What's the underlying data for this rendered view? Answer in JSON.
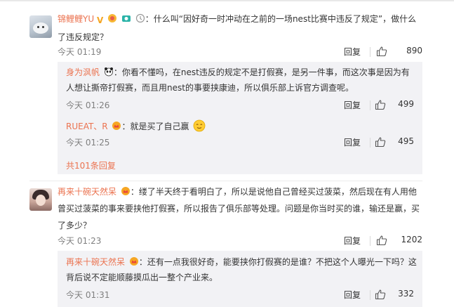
{
  "comment1": {
    "user": "锦鲤鲤YU",
    "content": "：什么叫“因好奇一时冲动在之前的一场nest比赛中违反了规定”，做什么了违反规定？",
    "time": "今天 01:19",
    "reply_label": "回复",
    "likes": "890",
    "replies": [
      {
        "user": "身为沨帆",
        "content": "：你看不懂吗，在nest违反的规定不是打假赛，是另一件事，而这次事是因为有人想让撕帝打假赛，而且用nest的事要挟康迪，所以俱乐部上诉官方调查呢。",
        "time": "今天 01:26",
        "reply_label": "回复",
        "likes": "499"
      },
      {
        "user": "RUEAT、R",
        "content": "：就是买了自己赢",
        "time": "今天 01:25",
        "reply_label": "回复",
        "likes": "495"
      }
    ],
    "more_replies": "共101条回复"
  },
  "comment2": {
    "user": "再来十碗天然呆",
    "content": "：缕了半天终于看明白了，所以是说他自己曾经买过菠菜，然后现在有人用他曾买过菠菜的事来要挟他打假赛，所以报告了俱乐部等处理。问题是你当时买的谁，输还是赢，买了多少？",
    "time": "今天 01:23",
    "reply_label": "回复",
    "likes": "1202",
    "replies": [
      {
        "user": "再来十碗天然呆",
        "content": "：还有一点我很好奇，能要挟你打假赛的是谁？不把这个人曝光一下吗？这背后说不定能顺藤摸瓜出一整个产业来。",
        "time": "今天 01:31",
        "reply_label": "回复",
        "likes": "332"
      }
    ]
  }
}
